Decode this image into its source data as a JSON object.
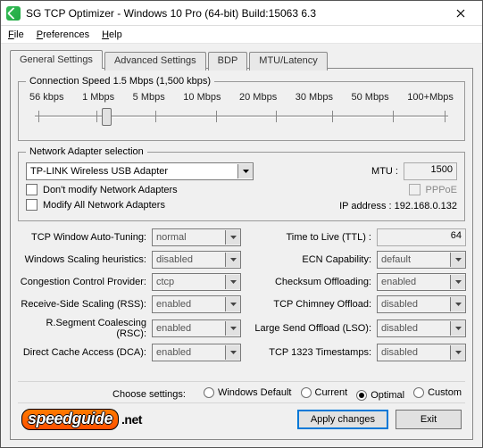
{
  "title": "SG TCP Optimizer - Windows 10 Pro (64-bit) Build:15063 6.3",
  "menu": {
    "file": "File",
    "prefs": "Preferences",
    "help": "Help"
  },
  "tabs": {
    "general": "General Settings",
    "advanced": "Advanced Settings",
    "bdp": "BDP",
    "mtu": "MTU/Latency"
  },
  "speed": {
    "legend": "Connection Speed  1.5 Mbps (1,500 kbps)",
    "marks": [
      "56 kbps",
      "1 Mbps",
      "5 Mbps",
      "10 Mbps",
      "20 Mbps",
      "30 Mbps",
      "50 Mbps",
      "100+Mbps"
    ]
  },
  "adapter": {
    "legend": "Network Adapter selection",
    "selected": "TP-LINK Wireless USB Adapter",
    "dontModify": "Don't modify Network Adapters",
    "modifyAll": "Modify All Network Adapters",
    "mtuLabel": "MTU :",
    "mtuValue": "1500",
    "pppoe": "PPPoE",
    "ipLabel": "IP address :",
    "ipValue": "192.168.0.132"
  },
  "settings": {
    "left": [
      {
        "label": "TCP Window Auto-Tuning:",
        "value": "normal"
      },
      {
        "label": "Windows Scaling heuristics:",
        "value": "disabled"
      },
      {
        "label": "Congestion Control Provider:",
        "value": "ctcp"
      },
      {
        "label": "Receive-Side Scaling (RSS):",
        "value": "enabled"
      },
      {
        "label": "R.Segment Coalescing (RSC):",
        "value": "enabled"
      },
      {
        "label": "Direct Cache Access (DCA):",
        "value": "enabled"
      }
    ],
    "right": [
      {
        "label": "Time to Live (TTL) :",
        "value": "64",
        "type": "text"
      },
      {
        "label": "ECN Capability:",
        "value": "default"
      },
      {
        "label": "Checksum Offloading:",
        "value": "enabled"
      },
      {
        "label": "TCP Chimney Offload:",
        "value": "disabled"
      },
      {
        "label": "Large Send Offload (LSO):",
        "value": "disabled"
      },
      {
        "label": "TCP 1323 Timestamps:",
        "value": "disabled"
      }
    ]
  },
  "choose": {
    "label": "Choose settings:",
    "opts": [
      "Windows Default",
      "Current",
      "Optimal",
      "Custom"
    ],
    "selected": "Optimal"
  },
  "buttons": {
    "apply": "Apply changes",
    "exit": "Exit"
  },
  "logo": {
    "brand": "speedguide",
    "suffix": ".net"
  }
}
